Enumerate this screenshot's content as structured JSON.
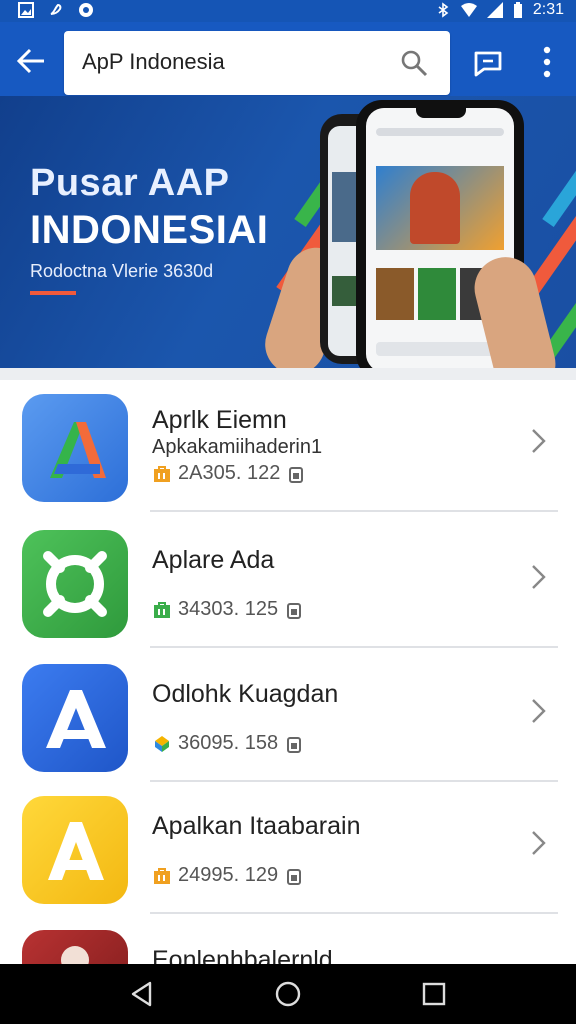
{
  "status_bar": {
    "time": "2:31"
  },
  "search": {
    "value": "ApP Indonesia"
  },
  "banner": {
    "title_line1": "Pusar AAP",
    "title_line2": "INDONESIAI",
    "subtitle": "Rodoctna Vlerie 3630d"
  },
  "apps": [
    {
      "name": "Aprlk Eiemn",
      "developer": "Apkakamiihaderin1",
      "meta": "2A305. 122",
      "icon": "letter-a-multicolor-icon",
      "color": "#3a7be0"
    },
    {
      "name": "Aplare Ada",
      "developer": "",
      "meta": "34303. 125",
      "icon": "ring-crosshair-icon",
      "color": "#3aad4a"
    },
    {
      "name": "Odlohk Kuagdan",
      "developer": "",
      "meta": "36095. 158",
      "icon": "letter-a-white-icon",
      "color": "#2864d8"
    },
    {
      "name": "Apalkan Itaabarain",
      "developer": "",
      "meta": "24995. 129",
      "icon": "letter-a-yellow-icon",
      "color": "#f5c518"
    },
    {
      "name": "Eonlenhbalernld",
      "developer": "",
      "meta": "",
      "icon": "red-app-icon",
      "color": "#a52a2a"
    }
  ],
  "colors": {
    "primary": "#1759c1",
    "accent": "#f05a3c"
  }
}
